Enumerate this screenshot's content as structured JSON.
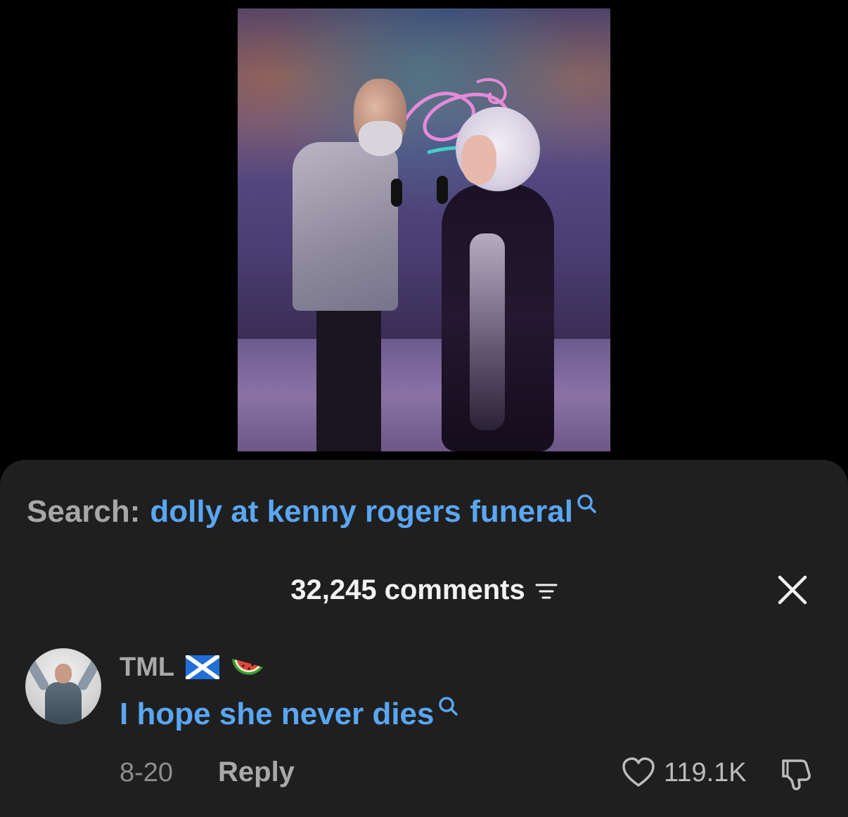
{
  "search": {
    "label": "Search:",
    "query": "dolly at kenny rogers funeral"
  },
  "comments_header": {
    "count_label": "32,245 comments"
  },
  "comment": {
    "username": "TML",
    "text": "I hope she never dies",
    "date": "8-20",
    "reply_label": "Reply",
    "likes": "119.1K",
    "emoji": [
      "scotland-flag-icon",
      "watermelon-icon"
    ]
  },
  "colors": {
    "link_blue": "#5aa6f2",
    "sheet_bg": "#1f1f1f",
    "page_bg": "#000000"
  }
}
